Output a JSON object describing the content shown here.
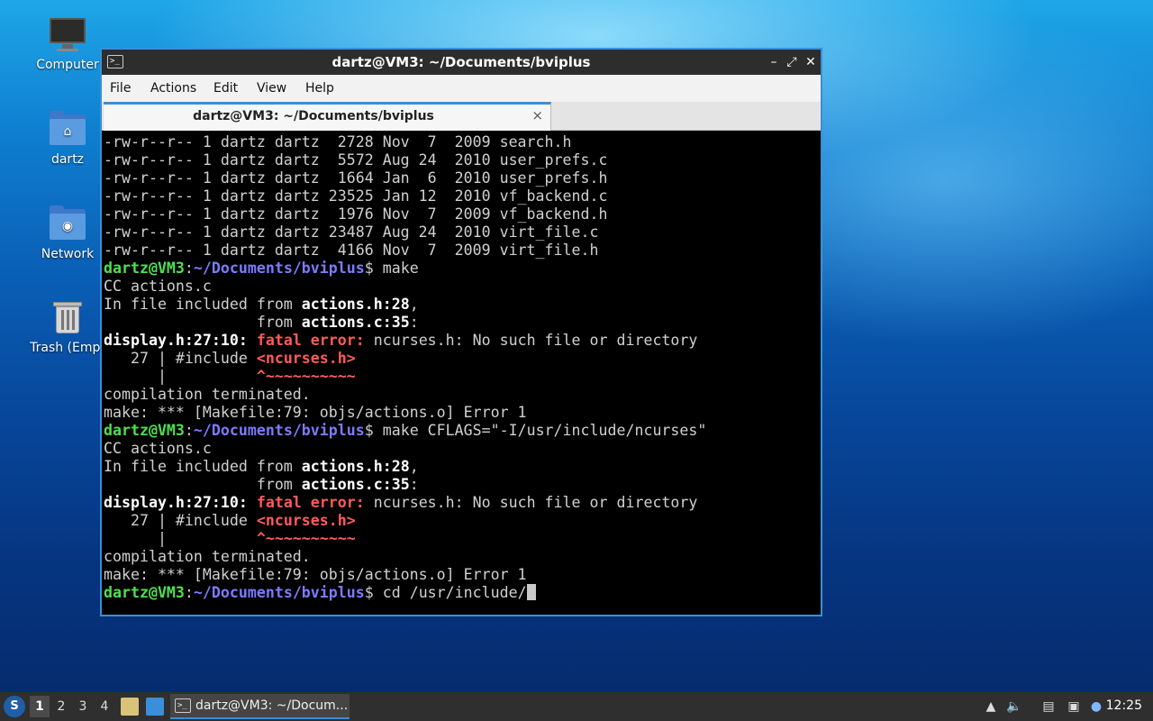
{
  "desktop": {
    "icons": [
      {
        "label": "Computer",
        "icon": "computer-icon"
      },
      {
        "label": "dartz",
        "icon": "home-folder-icon"
      },
      {
        "label": "Network",
        "icon": "network-folder-icon"
      },
      {
        "label": "Trash (Empt",
        "icon": "trash-icon"
      }
    ]
  },
  "window": {
    "title": "dartz@VM3: ~/Documents/bviplus",
    "controls": {
      "minimize": "–",
      "maximize": "⤢",
      "close": "✕"
    },
    "menu": [
      "File",
      "Actions",
      "Edit",
      "View",
      "Help"
    ],
    "tab": {
      "label": "dartz@VM3: ~/Documents/bviplus",
      "close": "×"
    }
  },
  "terminal": {
    "prompt_user": "dartz@VM3",
    "prompt_path": "~/Documents/bviplus",
    "listing": [
      "-rw-r--r-- 1 dartz dartz  2728 Nov  7  2009 search.h",
      "-rw-r--r-- 1 dartz dartz  5572 Aug 24  2010 user_prefs.c",
      "-rw-r--r-- 1 dartz dartz  1664 Jan  6  2010 user_prefs.h",
      "-rw-r--r-- 1 dartz dartz 23525 Jan 12  2010 vf_backend.c",
      "-rw-r--r-- 1 dartz dartz  1976 Nov  7  2009 vf_backend.h",
      "-rw-r--r-- 1 dartz dartz 23487 Aug 24  2010 virt_file.c",
      "-rw-r--r-- 1 dartz dartz  4166 Nov  7  2009 virt_file.h"
    ],
    "cmd1": "$ make",
    "cmd2": "$ make CFLAGS=\"-I/usr/include/ncurses\"",
    "cmd3": "$ cd /usr/include/",
    "cc_line": "CC actions.c",
    "inc_prefix": "In file included from ",
    "inc_file1": "actions.h:28",
    "from_prefix": "                 from ",
    "inc_file2": "actions.c:35",
    "err_loc": "display.h:27:10:",
    "err_kw": "fatal error:",
    "err_msg": " ncurses.h: No such file or directory",
    "src_prefix": "   27 | #include ",
    "src_hdr": "<ncurses.h>",
    "caret_prefix": "      |          ",
    "caret": "^~~~~~~~~~~",
    "terminated": "compilation terminated.",
    "make_err": "make: *** [Makefile:79: objs/actions.o] Error 1"
  },
  "taskbar": {
    "start": "S",
    "workspaces": [
      "1",
      "2",
      "3",
      "4"
    ],
    "task_label": "dartz@VM3: ~/Docum...",
    "clock": "12:25"
  }
}
